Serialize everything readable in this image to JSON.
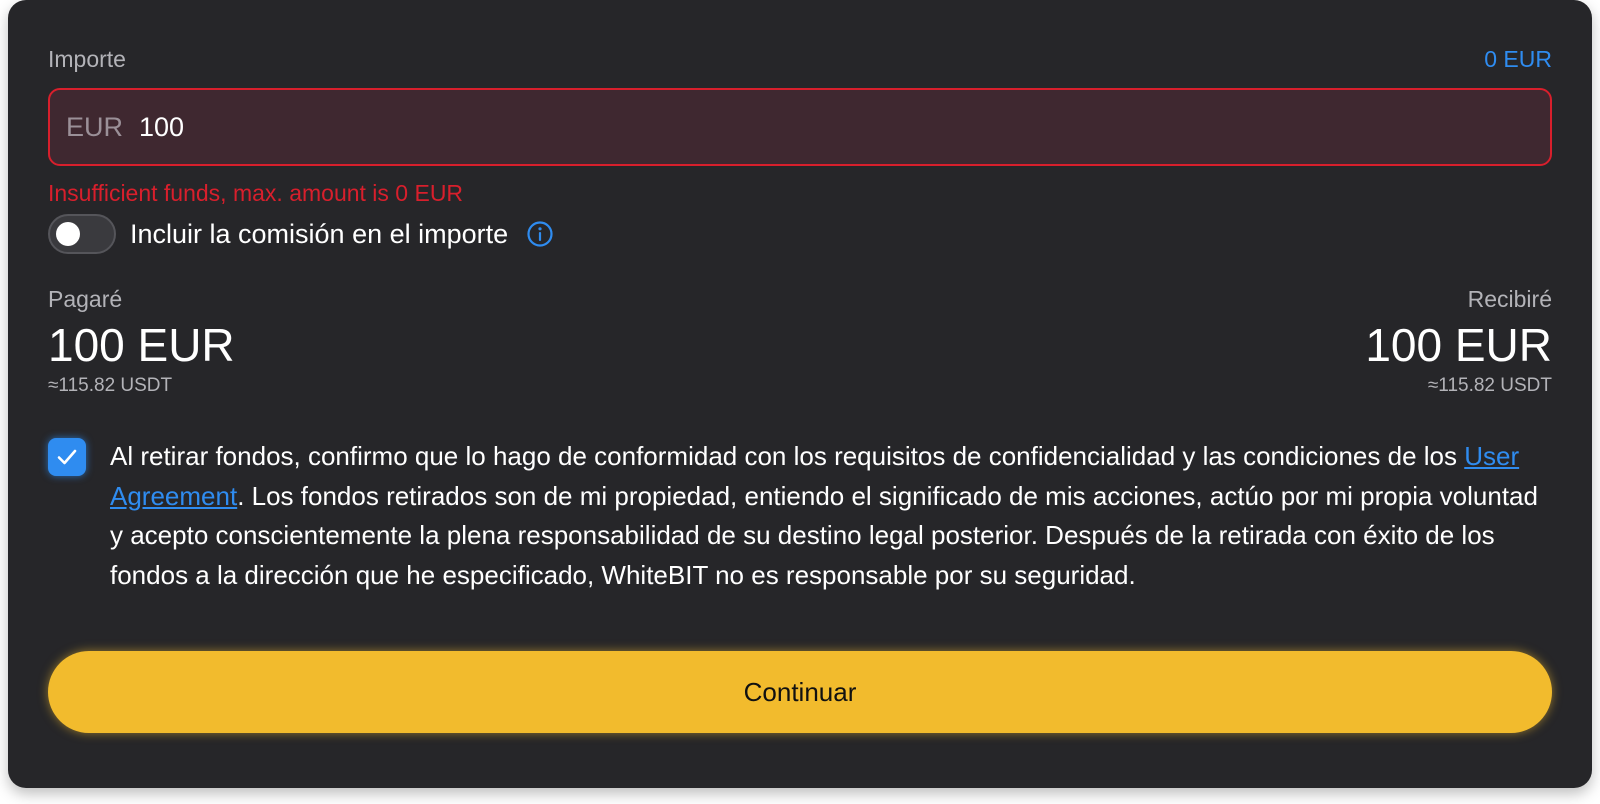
{
  "amount": {
    "label": "Importe",
    "available_balance": "0 EUR",
    "currency": "EUR",
    "value": "100",
    "error": "Insufficient funds, max. amount is 0 EUR"
  },
  "fee_toggle": {
    "label": "Incluir la comisión en el importe",
    "on": false
  },
  "pay": {
    "label": "Pagaré",
    "amount": "100 EUR",
    "approx": "≈115.82 USDT"
  },
  "receive": {
    "label": "Recibiré",
    "amount": "100 EUR",
    "approx": "≈115.82 USDT"
  },
  "agreement": {
    "checked": true,
    "text_before": "Al retirar fondos, confirmo que lo hago de conformidad con los requisitos de confidencialidad y las condiciones de los ",
    "link_label": "User Agreement",
    "text_after": ". Los fondos retirados son de mi propiedad, entiendo el significado de mis acciones, actúo por mi propia voluntad y acepto conscientemente la plena responsabilidad de su destino legal posterior. Después de la retirada con éxito de los fondos a la dirección que he especificado, WhiteBIT no es responsable por su seguridad."
  },
  "continue_label": "Continuar",
  "colors": {
    "card_background": "#262629",
    "accent_blue": "#2f8cf0",
    "error_red": "#d81f2c",
    "button_yellow": "#f2bb2d"
  },
  "icons": [
    "info-icon",
    "check-icon"
  ]
}
